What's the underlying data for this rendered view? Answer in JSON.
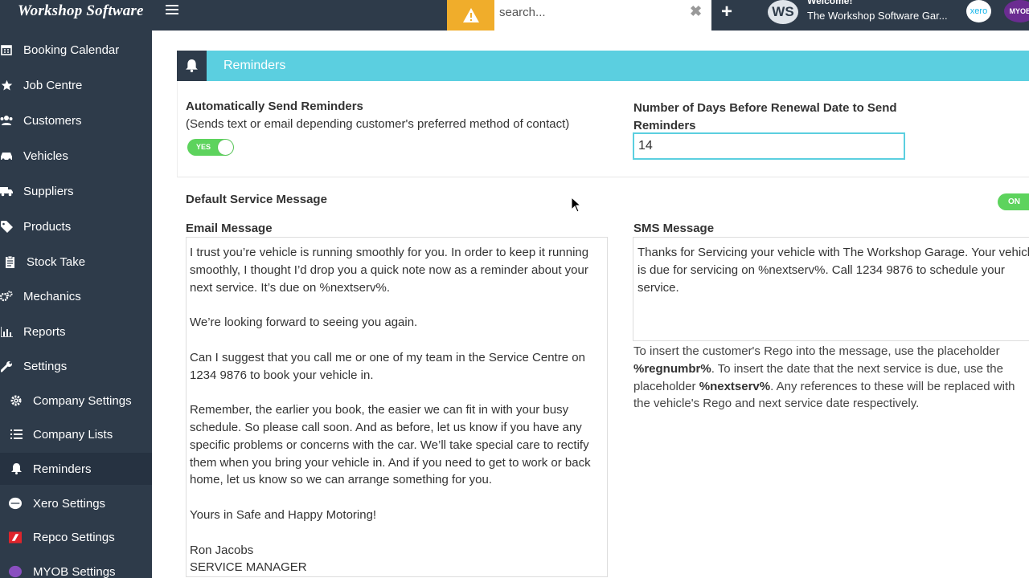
{
  "header": {
    "brand": "Workshop Software",
    "search_placeholder": "search...",
    "welcome": "Welcome!",
    "garage_name": "The Workshop Software Gar...",
    "avatar_initials": "WS",
    "xero_label": "xero",
    "myob_label": "MYOB",
    "accent_warning": "#f0ad2b"
  },
  "sidebar": {
    "items": [
      {
        "label": "Booking Calendar",
        "icon": "calendar-icon"
      },
      {
        "label": "Job Centre",
        "icon": "star-icon"
      },
      {
        "label": "Customers",
        "icon": "users-icon"
      },
      {
        "label": "Vehicles",
        "icon": "car-icon"
      },
      {
        "label": "Suppliers",
        "icon": "truck-icon"
      },
      {
        "label": "Products",
        "icon": "tag-icon"
      },
      {
        "label": "Stock Take",
        "icon": "clipboard-icon"
      },
      {
        "label": "Mechanics",
        "icon": "cogs-icon"
      },
      {
        "label": "Reports",
        "icon": "bar-chart-icon"
      },
      {
        "label": "Settings",
        "icon": "wrench-icon"
      },
      {
        "label": "Company Settings",
        "icon": "gear-icon"
      },
      {
        "label": "Company Lists",
        "icon": "list-icon"
      },
      {
        "label": "Reminders",
        "icon": "bell-icon"
      },
      {
        "label": "Xero Settings",
        "icon": "xero-icon"
      },
      {
        "label": "Repco Settings",
        "icon": "repco-icon"
      },
      {
        "label": "MYOB Settings",
        "icon": "myob-icon"
      }
    ],
    "active": "Reminders"
  },
  "panel": {
    "title": "Reminders",
    "auto_send_label": "Automatically Send Reminders",
    "auto_send_sub": "(Sends text or email depending customer's preferred method of contact)",
    "auto_send_toggle": "YES",
    "days_label": "Number of Days Before Renewal Date to Send Reminders",
    "days_value": "14",
    "default_label": "Default Service Message",
    "default_toggle": "ON",
    "email_label": "Email Message",
    "email_value": "I trust you’re vehicle is running smoothly for you. In order to keep it running smoothly, I thought I’d drop you a quick note now as a reminder about your next service. It’s due on %nextserv%.\n\nWe’re looking forward to seeing you again.\n\nCan I suggest that you call me or one of my team in the Service Centre on 1234 9876 to book your vehicle in.\n\nRemember, the earlier you book, the easier we can fit in with your busy schedule. So please call soon. And as before, let us know if you have any specific problems or concerns with the car. We’ll take special care to rectify them when you bring your vehicle in. And if you need to get to work or back home, let us know so we can arrange something for you.\n\nYours in Safe and Happy Motoring!\n\nRon Jacobs\nSERVICE MANAGER",
    "sms_label": "SMS Message",
    "sms_value": "Thanks for Servicing your vehicle with The Workshop Garage. Your vehicle is due for servicing on %nextserv%. Call 1234 9876 to schedule your service.",
    "help_part1": "To insert the customer's Rego into the message, use the placeholder ",
    "help_placeholder1": "%regnumbr%",
    "help_part2": ". To insert the date that the next service is due, use the placeholder ",
    "help_placeholder2": "%nextserv%",
    "help_part3": ". Any references to these will be replaced with the vehicle's Rego and next service date respectively.",
    "accent_color": "#5bcfe0",
    "toggle_color": "#5dd35d"
  }
}
